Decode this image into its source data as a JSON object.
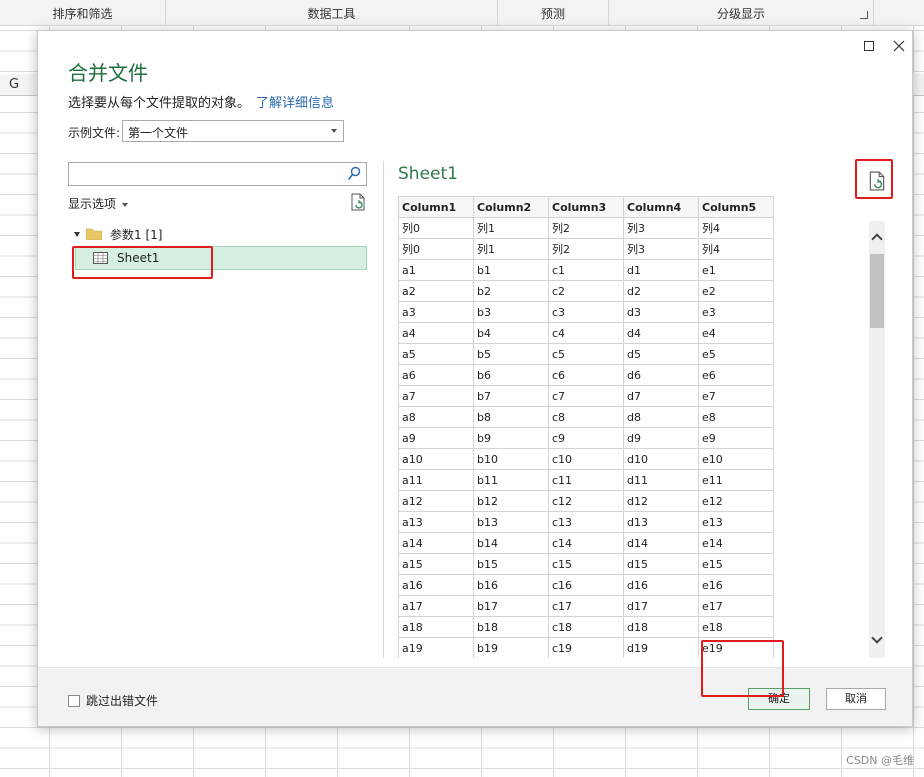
{
  "ribbon": {
    "groups": [
      "排序和筛选",
      "数据工具",
      "预测",
      "分级显示"
    ]
  },
  "sheet": {
    "column_header": "G"
  },
  "watermark": "CSDN @毛维",
  "dialog": {
    "title": "合并文件",
    "subtitle": "选择要从每个文件提取的对象。",
    "learn_more": "了解详细信息",
    "sample_label": "示例文件:",
    "sample_value": "第一个文件",
    "search_placeholder": "",
    "display_options": "显示选项",
    "tree": {
      "param": "参数1 [1]",
      "sheet": "Sheet1"
    },
    "preview": {
      "title": "Sheet1",
      "columns": [
        "Column1",
        "Column2",
        "Column3",
        "Column4",
        "Column5"
      ],
      "rows": [
        [
          "列0",
          "列1",
          "列2",
          "列3",
          "列4"
        ],
        [
          "列0",
          "列1",
          "列2",
          "列3",
          "列4"
        ],
        [
          "a1",
          "b1",
          "c1",
          "d1",
          "e1"
        ],
        [
          "a2",
          "b2",
          "c2",
          "d2",
          "e2"
        ],
        [
          "a3",
          "b3",
          "c3",
          "d3",
          "e3"
        ],
        [
          "a4",
          "b4",
          "c4",
          "d4",
          "e4"
        ],
        [
          "a5",
          "b5",
          "c5",
          "d5",
          "e5"
        ],
        [
          "a6",
          "b6",
          "c6",
          "d6",
          "e6"
        ],
        [
          "a7",
          "b7",
          "c7",
          "d7",
          "e7"
        ],
        [
          "a8",
          "b8",
          "c8",
          "d8",
          "e8"
        ],
        [
          "a9",
          "b9",
          "c9",
          "d9",
          "e9"
        ],
        [
          "a10",
          "b10",
          "c10",
          "d10",
          "e10"
        ],
        [
          "a11",
          "b11",
          "c11",
          "d11",
          "e11"
        ],
        [
          "a12",
          "b12",
          "c12",
          "d12",
          "e12"
        ],
        [
          "a13",
          "b13",
          "c13",
          "d13",
          "e13"
        ],
        [
          "a14",
          "b14",
          "c14",
          "d14",
          "e14"
        ],
        [
          "a15",
          "b15",
          "c15",
          "d15",
          "e15"
        ],
        [
          "a16",
          "b16",
          "c16",
          "d16",
          "e16"
        ],
        [
          "a17",
          "b17",
          "c17",
          "d17",
          "e17"
        ],
        [
          "a18",
          "b18",
          "c18",
          "d18",
          "e18"
        ],
        [
          "a19",
          "b19",
          "c19",
          "d19",
          "e19"
        ]
      ]
    },
    "skip_errors": "跳过出错文件",
    "ok": "确定",
    "cancel": "取消"
  },
  "colors": {
    "title_green": "#1e6e3e",
    "selection_green": "#d5efe0",
    "highlight_red": "#e21c1c",
    "link_blue": "#2a6ab0"
  },
  "icons": [
    "search-icon",
    "refresh-icon",
    "folder-icon",
    "table-icon",
    "maximize-icon",
    "close-icon",
    "scroll-up-icon",
    "scroll-down-icon"
  ]
}
